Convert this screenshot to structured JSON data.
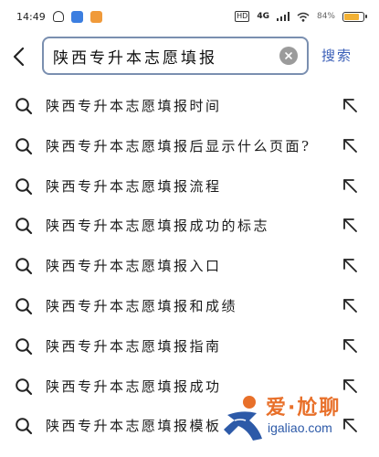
{
  "status_bar": {
    "time": "14:49",
    "network": "4G",
    "battery_text": "84%",
    "battery_level": 0.84
  },
  "search": {
    "query": "陕西专升本志愿填报",
    "button_label": "搜索"
  },
  "suggestions": [
    {
      "label": "陕西专升本志愿填报时间"
    },
    {
      "label": "陕西专升本志愿填报后显示什么页面?"
    },
    {
      "label": "陕西专升本志愿填报流程"
    },
    {
      "label": "陕西专升本志愿填报成功的标志"
    },
    {
      "label": "陕西专升本志愿填报入口"
    },
    {
      "label": "陕西专升本志愿填报和成绩"
    },
    {
      "label": "陕西专升本志愿填报指南"
    },
    {
      "label": "陕西专升本志愿填报成功"
    },
    {
      "label": "陕西专升本志愿填报模板"
    }
  ],
  "watermark": {
    "title": "爱·尬聊",
    "url": "igaliao.com"
  },
  "colors": {
    "accent": "#3b5fb8",
    "search_border": "#7a8fb0",
    "watermark_orange": "#e8702a",
    "watermark_blue": "#2d5aa8"
  }
}
